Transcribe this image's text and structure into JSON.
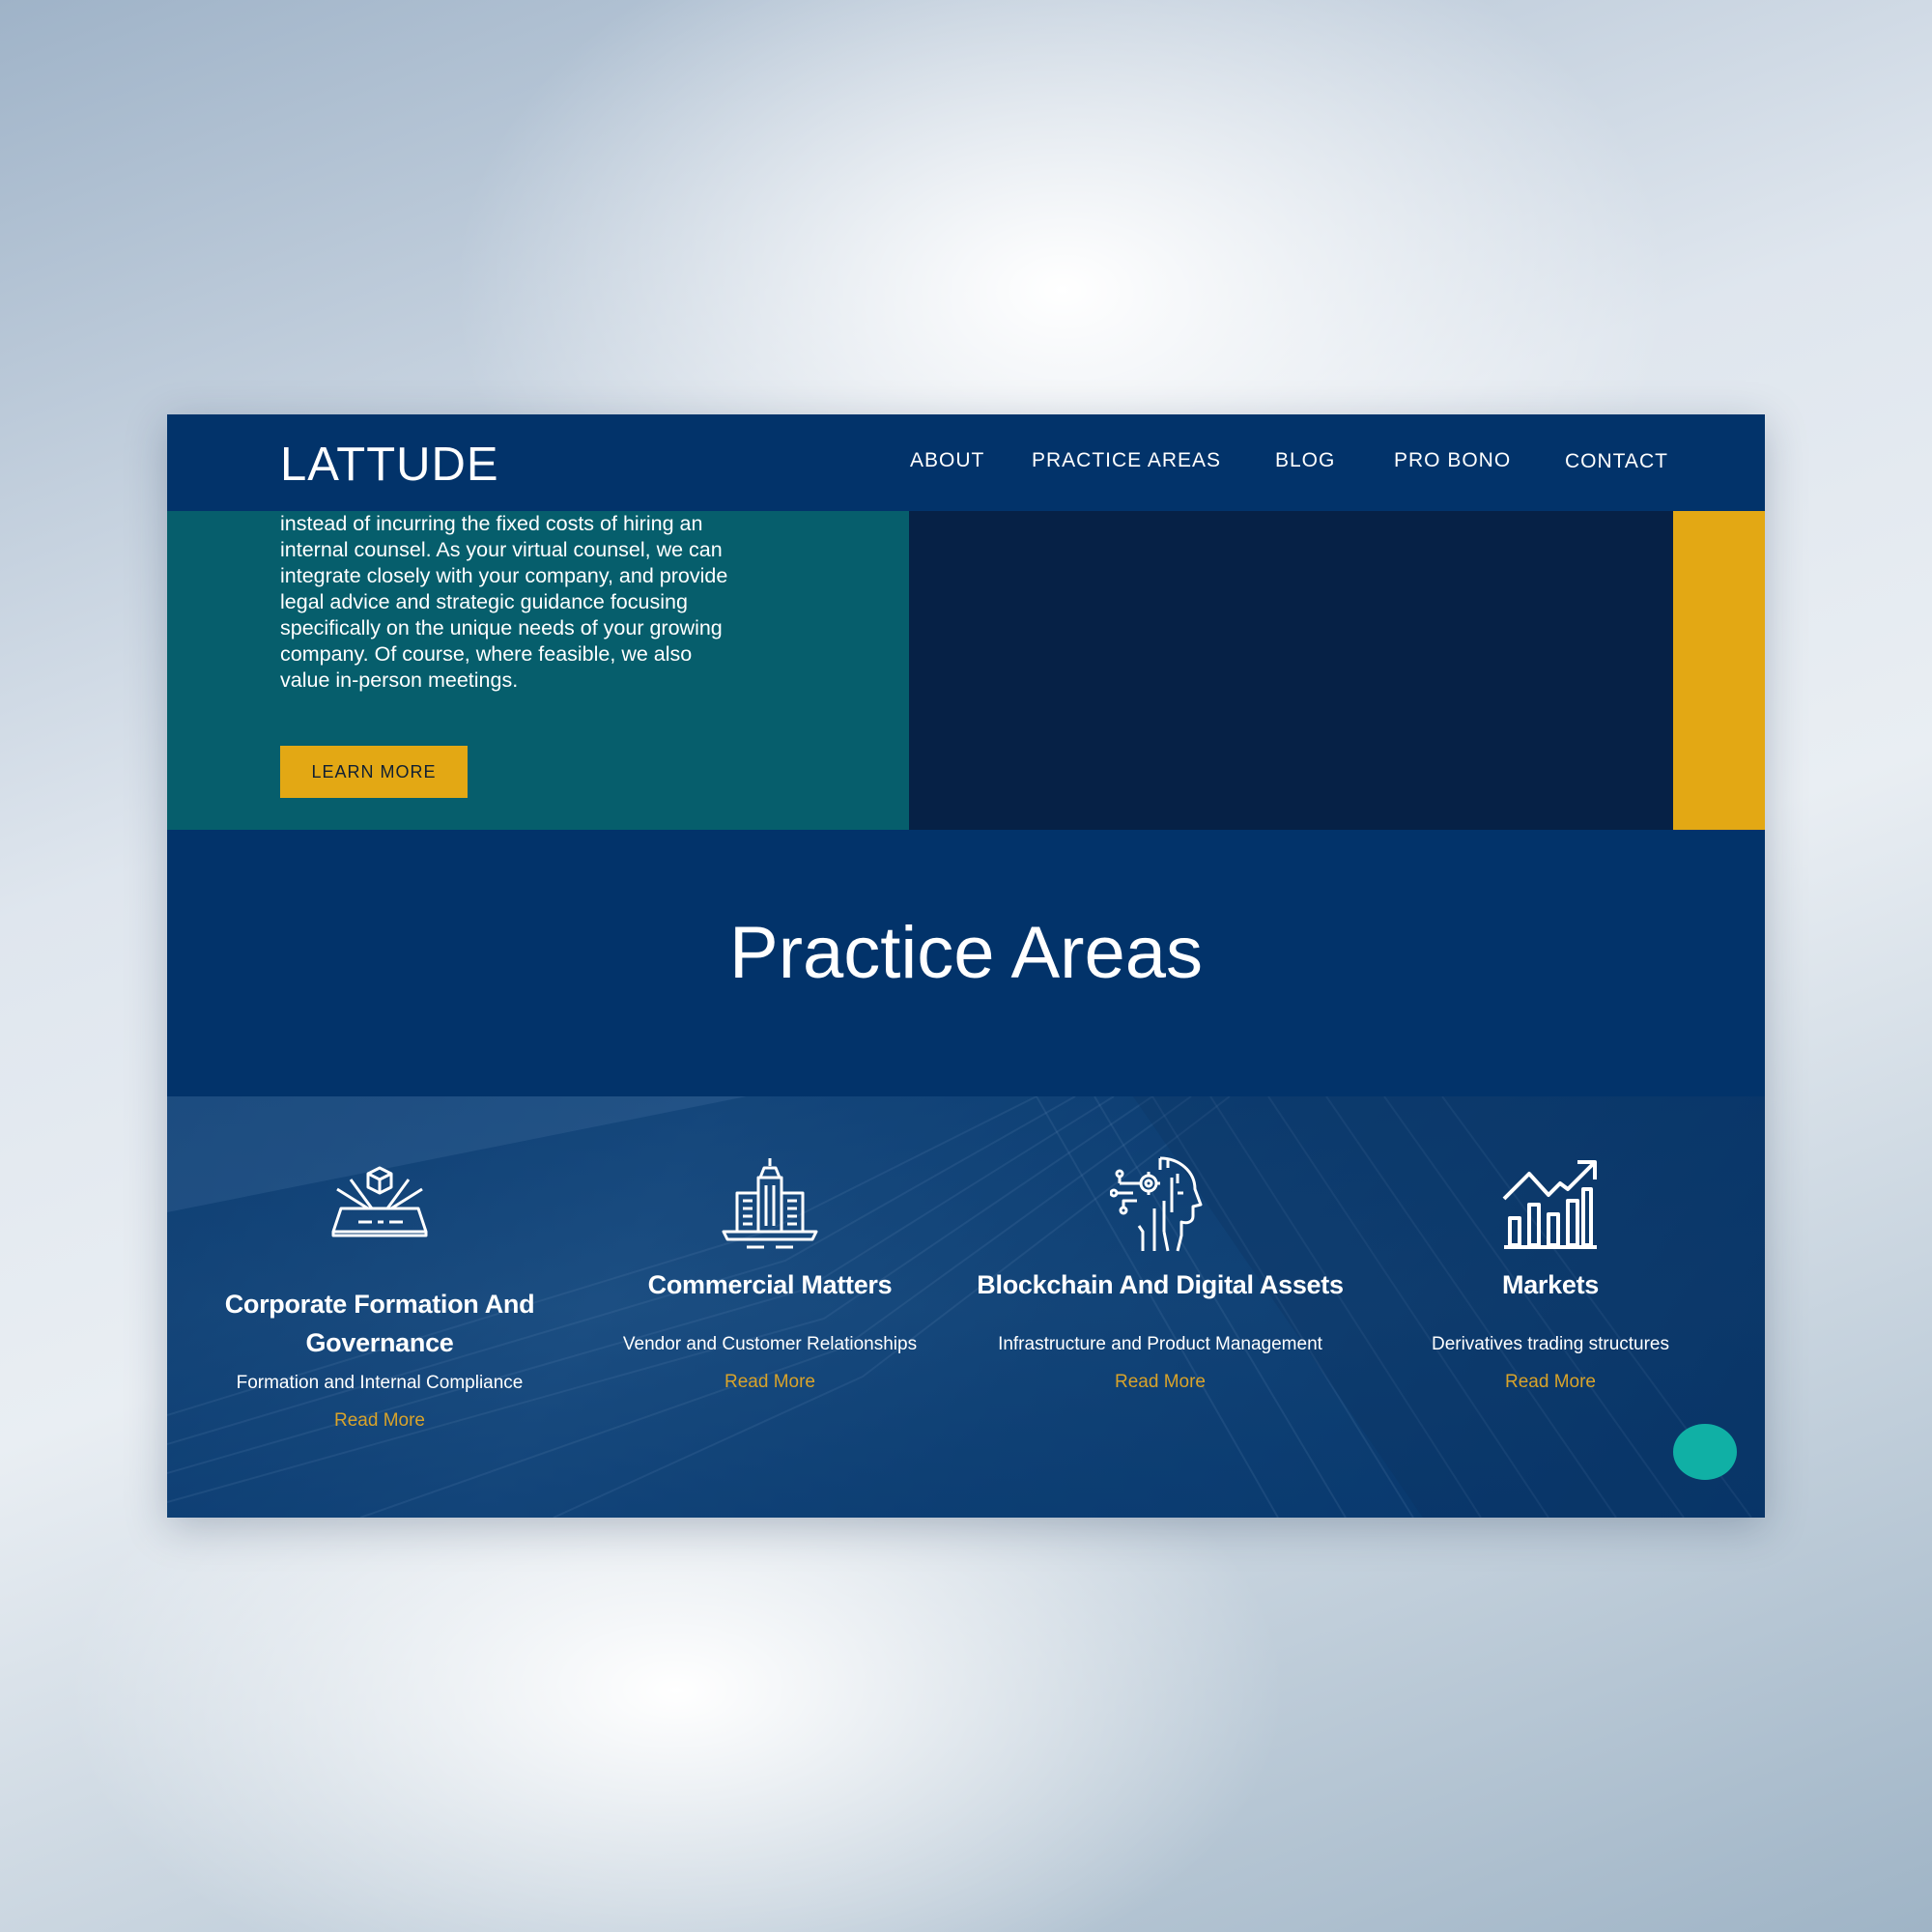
{
  "header": {
    "logo": "LATTUDE",
    "nav": [
      "ABOUT",
      "PRACTICE AREAS",
      "BLOG",
      "PRO BONO",
      "CONTACT"
    ]
  },
  "hero": {
    "text": "instead of incurring the fixed costs of hiring an internal counsel. As your virtual counsel, we can integrate closely with your company, and provide legal advice and strategic guidance focusing specifically on the unique needs of your growing company. Of course, where feasible, we also value in-person meetings.",
    "button": "LEARN MORE"
  },
  "practice": {
    "title": "Practice Areas",
    "cards": [
      {
        "title": "Corporate Formation And Governance",
        "subtitle": "Formation and Internal Compliance",
        "link": "Read More",
        "icon": "hologram-cube-icon"
      },
      {
        "title": "Commercial Matters",
        "subtitle": "Vendor and Customer Relationships",
        "link": "Read More",
        "icon": "city-buildings-icon"
      },
      {
        "title": "Blockchain And Digital Assets",
        "subtitle": "Infrastructure and Product Management",
        "link": "Read More",
        "icon": "ai-head-circuit-icon"
      },
      {
        "title": "Markets",
        "subtitle": "Derivatives trading structures",
        "link": "Read More",
        "icon": "growth-chart-icon"
      }
    ]
  },
  "colors": {
    "navy": "#02336a",
    "teal": "#065e6c",
    "dark_navy": "#062146",
    "gold": "#e3a814",
    "link_gold": "#d9a32a",
    "chat_teal": "#10b0a5"
  }
}
